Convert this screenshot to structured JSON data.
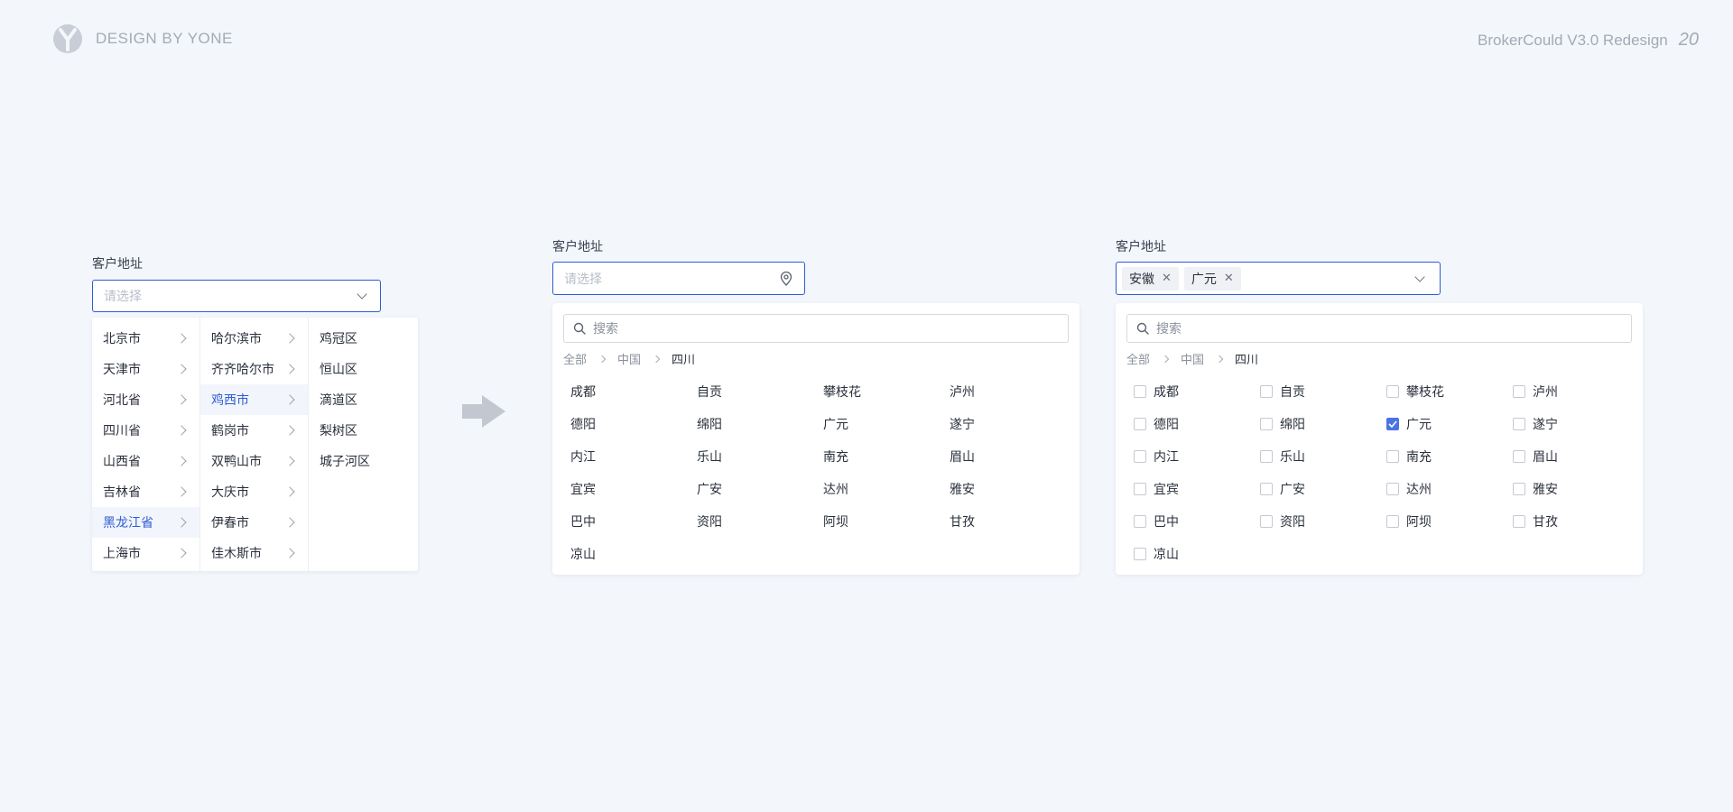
{
  "header": {
    "brand": "DESIGN BY YONE",
    "project_title": "BrokerCould V3.0 Redesign",
    "page_number": "20"
  },
  "colors": {
    "accent": "#2e5bd6",
    "background": "#f3f6fb",
    "checkbox_checked": "#4a73e6"
  },
  "cascader_demo": {
    "label": "客户地址",
    "placeholder": "请选择",
    "columns": [
      {
        "items": [
          "北京市",
          "天津市",
          "河北省",
          "四川省",
          "山西省",
          "吉林省",
          "黑龙江省",
          "上海市"
        ],
        "active_index": 6
      },
      {
        "items": [
          "哈尔滨市",
          "齐齐哈尔市",
          "鸡西市",
          "鹤岗市",
          "双鸭山市",
          "大庆市",
          "伊春市",
          "佳木斯市"
        ],
        "active_index": 2
      },
      {
        "items": [
          "鸡冠区",
          "恒山区",
          "滴道区",
          "梨树区",
          "城子河区"
        ]
      }
    ]
  },
  "single_select_demo": {
    "label": "客户地址",
    "placeholder": "请选择",
    "search_placeholder": "搜索",
    "breadcrumb": [
      "全部",
      "中国",
      "四川"
    ],
    "options": [
      "成都",
      "自贡",
      "攀枝花",
      "泸州",
      "德阳",
      "绵阳",
      "广元",
      "遂宁",
      "内江",
      "乐山",
      "南充",
      "眉山",
      "宜宾",
      "广安",
      "达州",
      "雅安",
      "巴中",
      "资阳",
      "阿坝",
      "甘孜",
      "凉山"
    ]
  },
  "multi_select_demo": {
    "label": "客户地址",
    "tags": [
      "安徽",
      "广元"
    ],
    "search_placeholder": "搜索",
    "breadcrumb": [
      "全部",
      "中国",
      "四川"
    ],
    "options": [
      "成都",
      "自贡",
      "攀枝花",
      "泸州",
      "德阳",
      "绵阳",
      "广元",
      "遂宁",
      "内江",
      "乐山",
      "南充",
      "眉山",
      "宜宾",
      "广安",
      "达州",
      "雅安",
      "巴中",
      "资阳",
      "阿坝",
      "甘孜",
      "凉山"
    ],
    "checked": [
      "广元"
    ]
  }
}
